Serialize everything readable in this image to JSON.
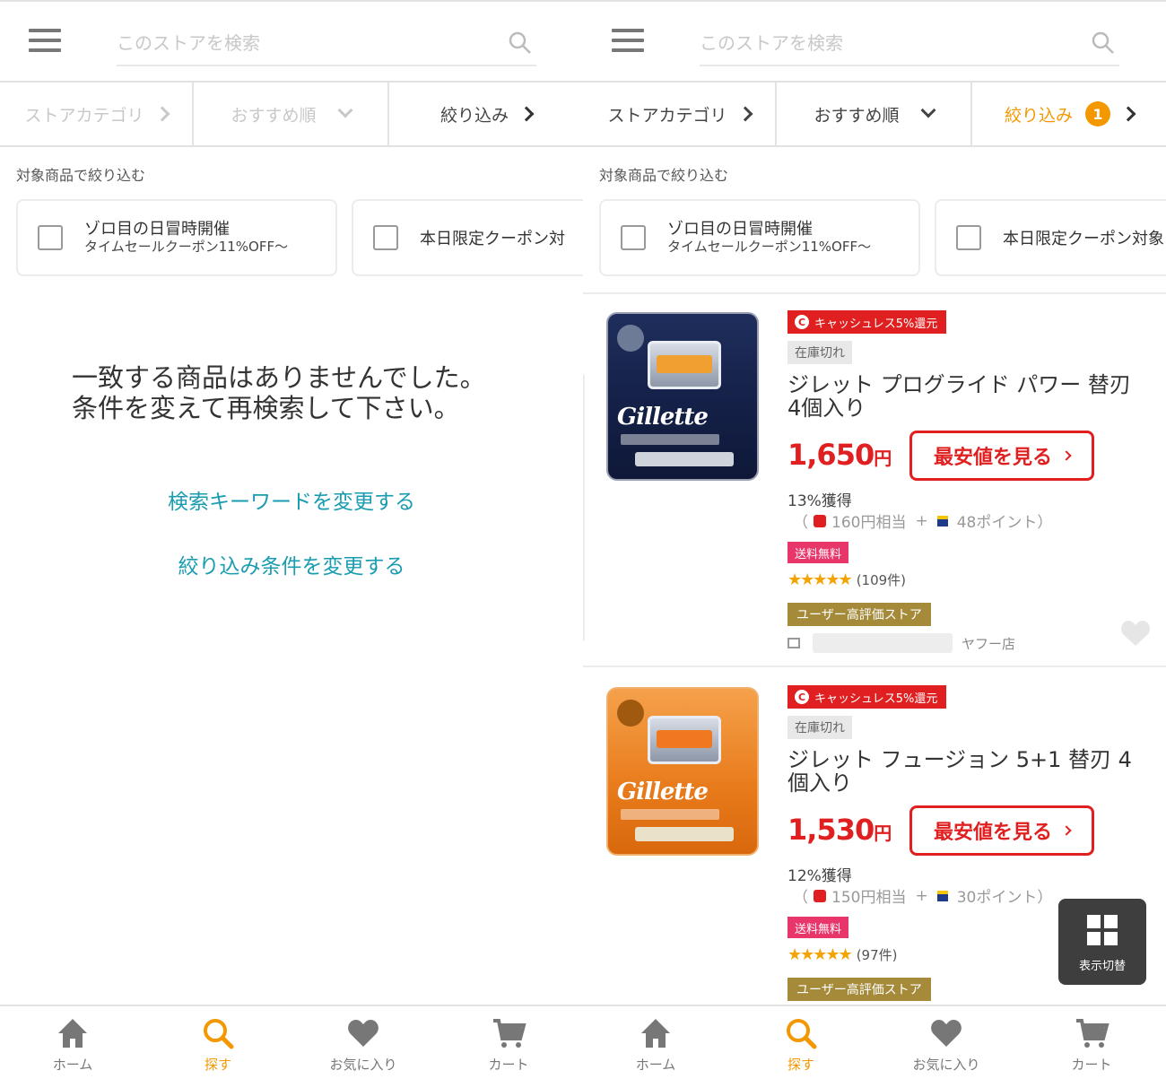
{
  "left": {
    "search": {
      "placeholder": "このストアを検索"
    },
    "filters": {
      "category": "ストアカテゴリ",
      "sort": "おすすめ順",
      "narrow": "絞り込み"
    },
    "target_label": "対象商品で絞り込む",
    "chips": [
      {
        "line1": "ゾロ目の日冒時開催",
        "line2": "タイムセールクーポン11%OFF～"
      },
      {
        "text": "本日限定クーポン対"
      }
    ],
    "empty_message": {
      "line1": "一致する商品はありませんでした。",
      "line2": "条件を変えて再検索して下さい。"
    },
    "links": {
      "change_keyword": "検索キーワードを変更する",
      "change_filter": "絞り込み条件を変更する"
    },
    "nav": {
      "home": "ホーム",
      "search": "探す",
      "favorites": "お気に入り",
      "cart": "カート"
    }
  },
  "right": {
    "search": {
      "placeholder": "このストアを検索"
    },
    "filters": {
      "category": "ストアカテゴリ",
      "sort": "おすすめ順",
      "narrow": "絞り込み",
      "narrow_count": "1"
    },
    "target_label": "対象商品で絞り込む",
    "chips": [
      {
        "line1": "ゾロ目の日冒時開催",
        "line2": "タイムセールクーポン11%OFF～"
      },
      {
        "text": "本日限定クーポン対象"
      }
    ],
    "products": [
      {
        "image_brand": "Gillette",
        "cashless": "キャッシュレス5%還元",
        "stock": "在庫切れ",
        "name": "ジレット プログライド パワー 替刃　4個入り",
        "price": "1,650",
        "yen": "円",
        "cheapest": "最安値を見る",
        "earn": "13%獲得",
        "points_open": "（",
        "points_yen": "160円相当",
        "points_plus": "+",
        "points_t": "48ポイント）",
        "shipping": "送料無料",
        "stars": "★★★★★",
        "reviews": "(109件)",
        "user_badge": "ユーザー高評価ストア",
        "store_suffix": "ヤフー店"
      },
      {
        "image_brand": "Gillette",
        "cashless": "キャッシュレス5%還元",
        "stock": "在庫切れ",
        "name": "ジレット フュージョン 5+1 替刃 4個入り",
        "price": "1,530",
        "yen": "円",
        "cheapest": "最安値を見る",
        "earn": "12%獲得",
        "points_open": "（",
        "points_yen": "150円相当",
        "points_plus": "+",
        "points_t": "30ポイント）",
        "shipping": "送料無料",
        "stars": "★★★★★",
        "reviews": "(97件)",
        "user_badge": "ユーザー高評価ストア"
      }
    ],
    "view_toggle": "表示切替",
    "nav": {
      "home": "ホーム",
      "search": "探す",
      "favorites": "お気に入り",
      "cart": "カート"
    }
  },
  "colors": {
    "accent_orange": "#f39800",
    "price_red": "#e02020",
    "link_teal": "#1a9cb0",
    "ship_pink": "#e8356a",
    "gold": "#a58a3a"
  }
}
